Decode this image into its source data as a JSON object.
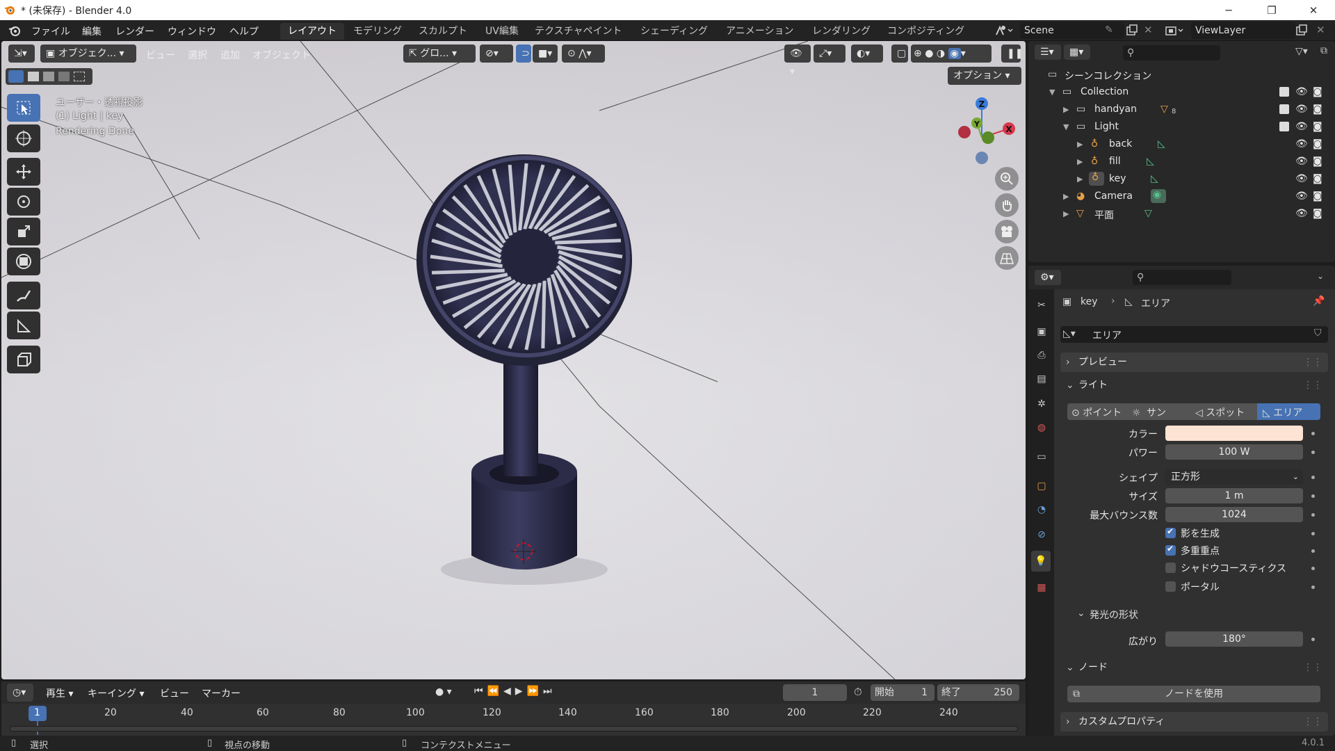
{
  "window": {
    "title": "* (未保存) - Blender 4.0"
  },
  "menu": {
    "file": "ファイル",
    "edit": "編集",
    "render": "レンダー",
    "window": "ウィンドウ",
    "help": "ヘルプ"
  },
  "workspaces": [
    "レイアウト",
    "モデリング",
    "スカルプト",
    "UV編集",
    "テクスチャペイント",
    "シェーディング",
    "アニメーション",
    "レンダリング",
    "コンポジティング"
  ],
  "scene": {
    "name": "Scene",
    "view_layer": "ViewLayer"
  },
  "viewport_header": {
    "mode": "オブジェク...",
    "view": "ビュー",
    "select": "選択",
    "add": "追加",
    "object": "オブジェクト",
    "transform": "グロ...",
    "options": "オプション"
  },
  "viewport_overlay": {
    "view_name": "ユーザー・透視投影",
    "active": "(1) Light | key",
    "status": "Rendering Done"
  },
  "gizmo": {
    "x": "X",
    "y": "Y",
    "z": "Z"
  },
  "outliner": {
    "root": "シーンコレクション",
    "rows": [
      {
        "name": "Collection"
      },
      {
        "name": "handyan",
        "badge": "8"
      },
      {
        "name": "Light"
      },
      {
        "name": "back"
      },
      {
        "name": "fill"
      },
      {
        "name": "key"
      },
      {
        "name": "Camera"
      },
      {
        "name": "平面"
      }
    ]
  },
  "properties": {
    "breadcrumb_object": "key",
    "breadcrumb_data": "エリア",
    "datablock": "エリア",
    "panels": {
      "preview": "プレビュー",
      "light": "ライト",
      "beam": "発光の形状",
      "nodes": "ノード",
      "custom": "カスタムプロパティ"
    },
    "light_types": [
      "ポイント",
      "サン",
      "スポット",
      "エリア"
    ],
    "active_light_type": "エリア",
    "color_label": "カラー",
    "color_value": "#fde3d3",
    "power_label": "パワー",
    "power": "100 W",
    "shape_label": "シェイプ",
    "shape": "正方形",
    "size_label": "サイズ",
    "size": "1 m",
    "bounces_label": "最大バウンス数",
    "bounces": "1024",
    "checkboxes": [
      {
        "label": "影を生成",
        "checked": true
      },
      {
        "label": "多重重点",
        "checked": true
      },
      {
        "label": "シャドウコースティクス",
        "checked": false
      },
      {
        "label": "ポータル",
        "checked": false
      }
    ],
    "spread_label": "広がり",
    "spread": "180°",
    "use_nodes": "ノードを使用"
  },
  "timeline": {
    "playback": "再生",
    "keying": "キーイング",
    "view": "ビュー",
    "marker": "マーカー",
    "current_frame": "1",
    "start_label": "開始",
    "start": "1",
    "end_label": "終了",
    "end": "250",
    "ticks": [
      "1",
      "20",
      "40",
      "60",
      "80",
      "100",
      "120",
      "140",
      "160",
      "180",
      "200",
      "220",
      "240"
    ]
  },
  "statusbar": {
    "select": "選択",
    "rotate": "視点の移動",
    "context": "コンテクストメニュー",
    "version": "4.0.1"
  }
}
